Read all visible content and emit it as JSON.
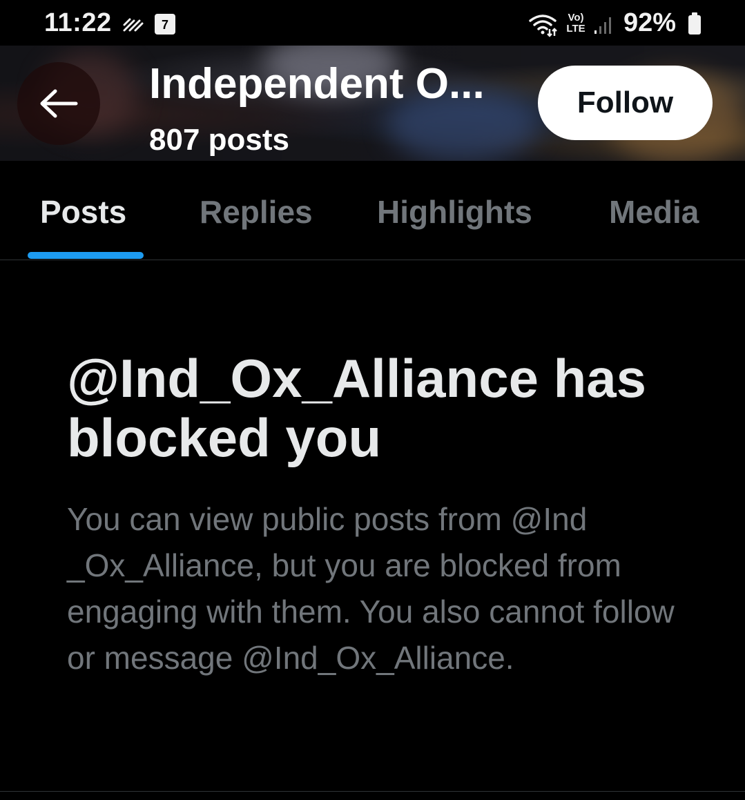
{
  "status_bar": {
    "time": "11:22",
    "calendar_day": "7",
    "battery": "92%",
    "network_label_top": "Vo)",
    "network_label_bottom": "LTE",
    "icons": [
      "data-saver-icon",
      "calendar-icon",
      "wifi-icon",
      "volte-icon",
      "signal-icon",
      "battery-icon"
    ]
  },
  "header": {
    "title": "Independent O...",
    "subtitle": "807 posts",
    "follow_label": "Follow",
    "back_icon": "arrow-left-icon"
  },
  "tabs": [
    {
      "label": "Posts",
      "active": true
    },
    {
      "label": "Replies",
      "active": false
    },
    {
      "label": "Highlights",
      "active": false
    },
    {
      "label": "Media",
      "active": false
    }
  ],
  "blocked": {
    "heading": "@Ind_Ox_Alliance has blocked you",
    "body": "You can view public posts from @Ind _Ox_Alliance, but you are blocked from engaging with them. You also cannot follow or message @Ind_Ox_Alliance."
  },
  "colors": {
    "background": "#000000",
    "accent": "#1d9bf0",
    "text_primary": "#e7e9ea",
    "text_secondary": "#71767b"
  }
}
